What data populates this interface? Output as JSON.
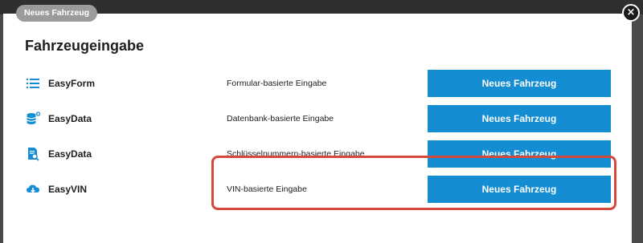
{
  "modal": {
    "tab_label": "Neues Fahrzeug",
    "close_symbol": "×",
    "title": "Fahrzeugeingabe"
  },
  "rows": [
    {
      "name": "EasyForm",
      "description": "Formular-basierte Eingabe",
      "button_label": "Neues Fahrzeug",
      "icon": "list-icon"
    },
    {
      "name": "EasyData",
      "description": "Datenbank-basierte Eingabe",
      "button_label": "Neues Fahrzeug",
      "icon": "database-icon"
    },
    {
      "name": "EasyData",
      "description": "Schlüsselnummern-basierte Eingabe",
      "button_label": "Neues Fahrzeug",
      "icon": "document-search-icon"
    },
    {
      "name": "EasyVIN",
      "description": "VIN-basierte Eingabe",
      "button_label": "Neues Fahrzeug",
      "icon": "cloud-download-icon"
    }
  ],
  "colors": {
    "accent": "#148dd2",
    "highlight": "#d4493a",
    "tab_background": "#9b9b9b"
  }
}
